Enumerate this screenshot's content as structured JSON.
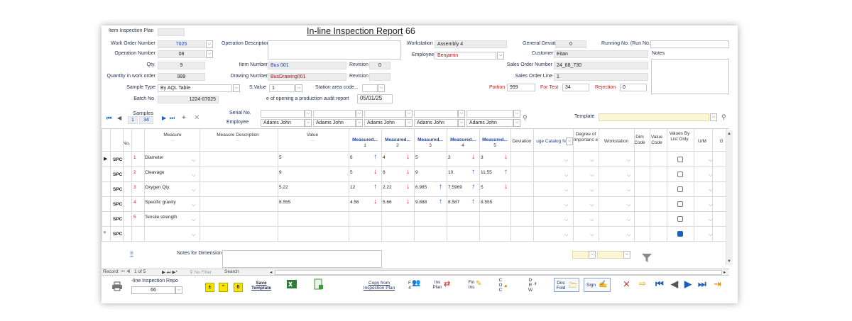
{
  "header": {
    "item_inspection_plan_label": "Item Inspection Plan",
    "title": "In-line Inspection Report",
    "report_no": "66"
  },
  "form": {
    "work_order_label": "Work Order Number",
    "work_order": "7025",
    "operation_number_label": "Operation Number",
    "operation_number": "08",
    "qty_label": "Qty.",
    "qty": "9",
    "qty_wo_label": "Quantity in work order",
    "qty_wo": "999",
    "sample_type_label": "Sample Type",
    "sample_type": "By AQL Table",
    "batch_label": "Batch No.",
    "batch": "1224-07025",
    "op_desc_label": "Operation Description",
    "item_number_label": "Item Number",
    "item_number": "Bus 001",
    "revision_label": "Revision",
    "revision": "0",
    "drawing_label": "Drawing Number",
    "drawing": "BusDrawing001",
    "revision2_label": "Revision",
    "svalue_label": "S.Value",
    "svalue": "1",
    "station_label": "Station area code...",
    "audit_date_label": "e of opening a production audit report",
    "audit_date": "05/01/25",
    "workstation_label": "Workstation",
    "workstation": "Assembly 4",
    "employee_label": "Employee",
    "employee": "Benjamin",
    "gen_dev_label": "General Deviation",
    "gen_dev": "0",
    "run_no_label": "Running No. (Run No.)",
    "customer_label": "Customer",
    "customer": "Eitan",
    "notes_label": "Notes",
    "sales_order_label": "Sales Order Number",
    "sales_order": "24_68_730",
    "sales_line_label": "Sales Order Line",
    "sales_line": "1",
    "portion_label": "Portion",
    "portion": "999",
    "for_test_label": "For Test",
    "for_test": "34",
    "rejection_label": "Rejection",
    "rejection": "0"
  },
  "samples": {
    "label": "Samples",
    "current": "1",
    "total": "34",
    "serial_label": "Serial No.",
    "employee_label": "Employee",
    "employees": [
      "Adams John",
      "Adams John",
      "Adams John",
      "Adams John",
      "Adams John"
    ],
    "template_label": "Template"
  },
  "grid": {
    "headers": {
      "no": "No.",
      "measure": "Measure",
      "measure_desc": "Measure Description",
      "value": "Value",
      "m1": "Measured...",
      "m2": "Measured...",
      "m3": "Measured...",
      "m4": "Measured...",
      "m5": "Measured...",
      "m1n": "1",
      "m2n": "2",
      "m3n": "3",
      "m4n": "4",
      "m5n": "5",
      "deviation": "Deviation",
      "gauge": "uge Catalog N",
      "degree": "Degree of Importanc e",
      "workstation": "Workstation",
      "dim_code": "Dim Code",
      "value_code": "Value Code",
      "values_by_list": "Values By List Only",
      "um": "U/M",
      "g": "G",
      "ellipsis": "..."
    },
    "spc": "SPC",
    "rows": [
      {
        "no": "1",
        "measure": "Diameter",
        "value": "5",
        "m": [
          "6",
          "4",
          "5",
          "2",
          "3"
        ],
        "dir": [
          "up",
          "dn",
          "",
          "dn",
          "dn"
        ]
      },
      {
        "no": "2",
        "measure": "Cleavage",
        "value": "9",
        "m": [
          "5",
          "6",
          "9",
          "10.",
          "11.55"
        ],
        "dir": [
          "dn",
          "dn",
          "",
          "up",
          "up"
        ]
      },
      {
        "no": "3",
        "measure": "Oxygen Qty.",
        "value": "5.22",
        "m": [
          "12",
          "2.22",
          "6.985",
          "7.5969",
          "5"
        ],
        "dir": [
          "up",
          "dn",
          "up",
          "up",
          "dn"
        ]
      },
      {
        "no": "4",
        "measure": "Specific gravity",
        "value": "8.555",
        "m": [
          "4.56",
          "5.66",
          "9.888",
          "8.587",
          "8.555"
        ],
        "dir": [
          "dn",
          "dn",
          "up",
          "up",
          ""
        ]
      },
      {
        "no": "5",
        "measure": "Tensile strength",
        "value": "",
        "m": [
          "",
          "",
          "",
          "",
          ""
        ],
        "dir": [
          "",
          "",
          "",
          "",
          ""
        ]
      }
    ],
    "notes_label": "Notes for Dimension"
  },
  "recordbar": {
    "record_label": "Record:",
    "position": "1 of 5",
    "filter": "No Filter",
    "search": "Search"
  },
  "footer": {
    "report_label": "-line Inspection Repo",
    "report_value": "66",
    "pm_label": "±",
    "quote_label": "\"",
    "zero_label": "0",
    "save_template": "Save Template",
    "copy_plan": "Copy from Inspection Plan",
    "f4": "F 4",
    "ins_plan": "Ins Plan",
    "fin_ins": "Fin Ins",
    "coc": "C O C",
    "drw": "D R W",
    "doc_fold": "Doc Fold",
    "sign": "Sign",
    "colors": {
      "nav": "#1f5fb8",
      "yellow": "#f5e400",
      "red": "#d8201a",
      "blue": "#1a59d1"
    }
  }
}
